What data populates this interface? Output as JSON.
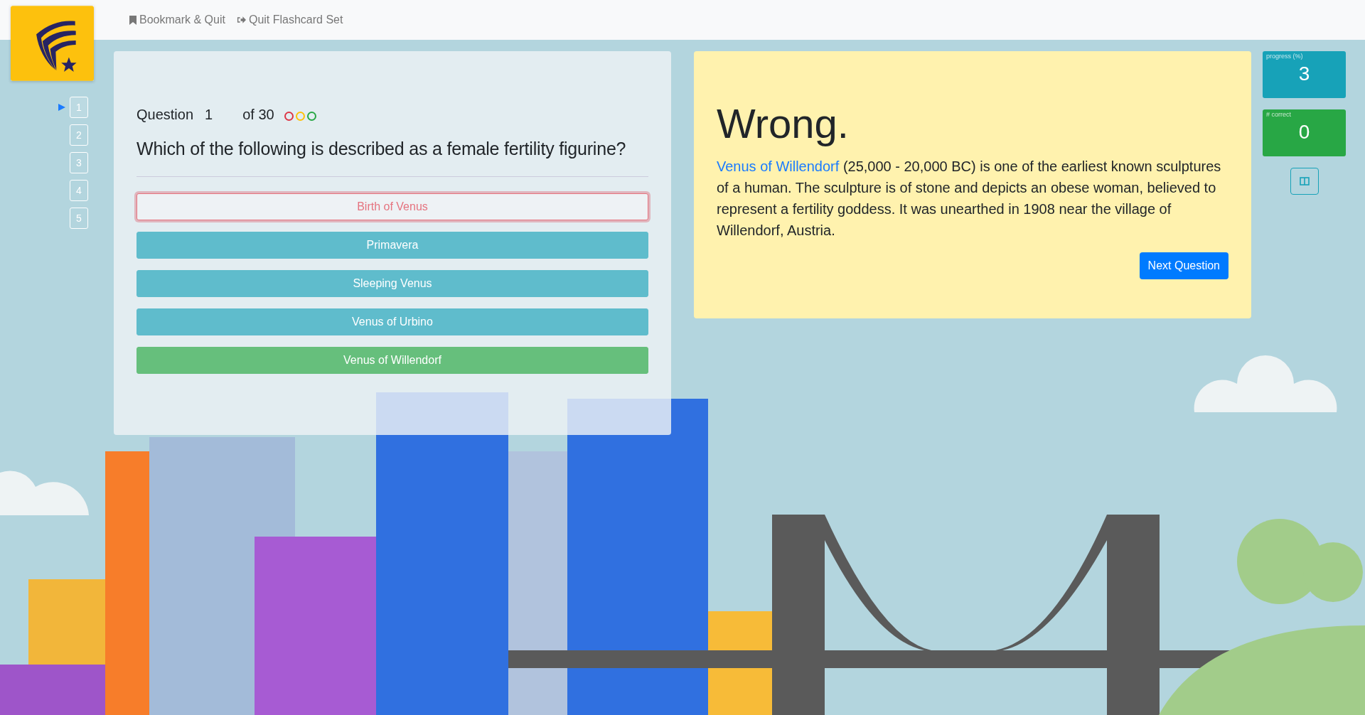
{
  "nav": [
    {
      "kind": "bookmark",
      "label": "Bookmark & Quit"
    },
    {
      "kind": "quit",
      "label": "Quit Flashcard Set"
    }
  ],
  "question_nav": [
    {
      "label": "1",
      "selected": true
    },
    {
      "label": "2",
      "selected": false
    },
    {
      "label": "3",
      "selected": false
    },
    {
      "label": "4",
      "selected": false
    },
    {
      "label": "5",
      "selected": false
    }
  ],
  "question": {
    "label": "Question",
    "number": "1",
    "total": "of 30",
    "indicators": [
      {
        "color": "#dc3545"
      },
      {
        "color": "#ffc107"
      },
      {
        "color": "#28a745"
      }
    ],
    "text": "Which of the following is described as a female fertility figurine?"
  },
  "answers": [
    {
      "label": "Birth of Venus",
      "kind": "wrong"
    },
    {
      "label": "Primavera",
      "kind": "option"
    },
    {
      "label": "Sleeping Venus",
      "kind": "option"
    },
    {
      "label": "Venus of Urbino",
      "kind": "option"
    },
    {
      "label": "Venus of Willendorf",
      "kind": "correct"
    }
  ],
  "feedback": {
    "heading": "Wrong.",
    "link": "Venus of Willendorf",
    "text": " (25,000 - 20,000 BC) is one of the earliest known sculptures of a human. The sculpture is of stone and depicts an obese woman, believed to represent a fertility goddess. It was unearthed in 1908 near the village of Willendorf, Austria.",
    "button": "Next Question"
  },
  "stats": [
    {
      "label": "progress (%)",
      "value": "3",
      "color": "#17a2b8"
    },
    {
      "label": "# correct",
      "value": "0",
      "color": "#28a745"
    }
  ]
}
